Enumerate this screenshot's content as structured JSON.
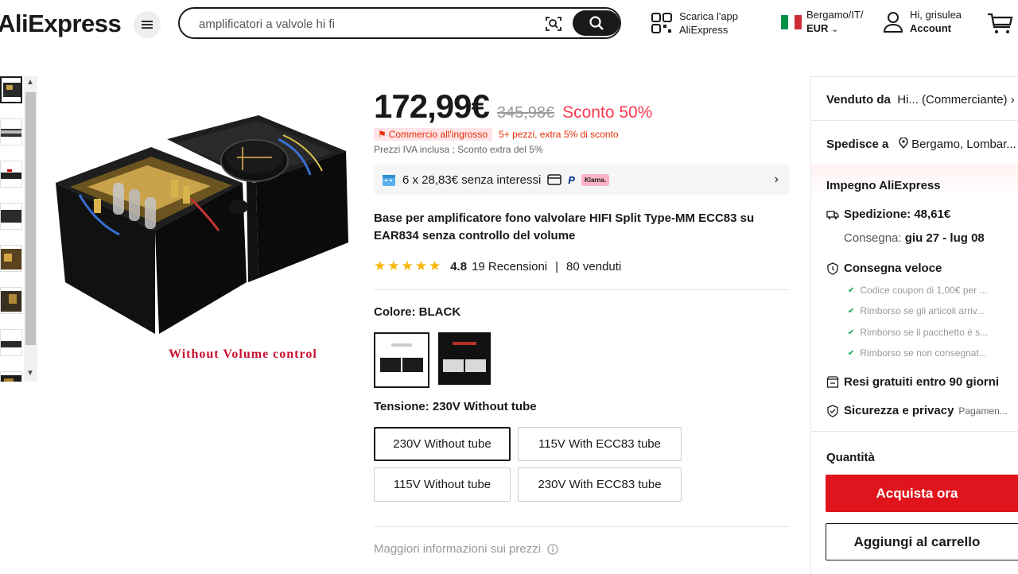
{
  "header": {
    "logo": "AliExpress",
    "search_placeholder": "amplificatori a valvole hi fi",
    "app_line1": "Scarica l'app",
    "app_line2": "AliExpress",
    "region_line1": "Bergamo/IT/",
    "region_line2": "EUR",
    "account_line1": "Hi, grisulea",
    "account_line2": "Account"
  },
  "gallery": {
    "caption": "Without Volume control",
    "thumb_count": 8
  },
  "product": {
    "price": "172,99€",
    "original_price": "345,98€",
    "discount": "Sconto 50%",
    "wholesale_badge": "Commercio all'ingrosso",
    "wholesale_extra": "5+ pezzi, extra 5% di sconto",
    "tax_note": "Prezzi IVA inclusa ; Sconto extra del 5%",
    "installments": "6 x 28,83€ senza interessi",
    "paypal": "P",
    "klarna": "Klarna.",
    "title": "Base per amplificatore fono valvolare HIFI Split Type-MM ECC83 su EAR834 senza controllo del volume",
    "rating": "4.8",
    "reviews": "19 Recensioni",
    "sold": "80 venduti",
    "color_label": "Colore: BLACK",
    "voltage_label": "Tensione: 230V Without tube",
    "voltage_options": [
      "230V Without tube",
      "115V With ECC83 tube",
      "115V Without tube",
      "230V With ECC83 tube"
    ],
    "more_info": "Maggiori informazioni sui prezzi"
  },
  "panel": {
    "sold_by_label": "Venduto da",
    "sold_by_value": "Hi... (Commerciante)",
    "ships_label": "Spedisce a",
    "ships_value": "Bergamo, Lombar...",
    "commitment": "Impegno AliExpress",
    "shipping": "Spedizione: 48,61€",
    "delivery_label": "Consegna:",
    "delivery_value": "giu 27 - lug 08",
    "fast_delivery": "Consegna veloce",
    "checks": [
      "Codice coupon di 1,00€ per ...",
      "Rimborso se gli articoli arriv...",
      "Rimborso se il pacchetto è s...",
      "Rimborso se non consegnat..."
    ],
    "returns": "Resi gratuiti entro 90 giorni",
    "security": "Sicurezza e privacy",
    "security_sub": "Pagamen...",
    "quantity": "Quantità",
    "buy_now": "Acquista ora",
    "add_to_cart": "Aggiungi al carrello"
  },
  "colors": {
    "accent_red": "#e0141c",
    "discount_red": "#fd384f",
    "star": "#f9b50b"
  }
}
